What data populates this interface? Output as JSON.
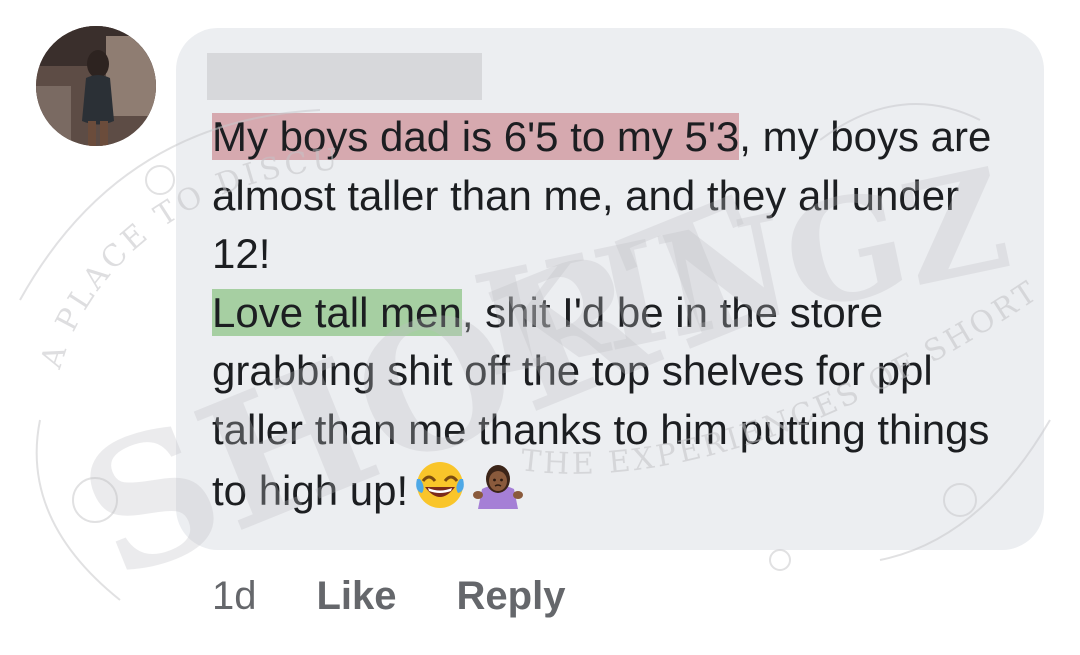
{
  "comment": {
    "author_name_redacted": true,
    "text": {
      "highlight_1": "My boys dad is 6'5 to my 5'3",
      "part_1": ", my boys are almost taller than me, and they all under 12!",
      "highlight_2": "Love tall men",
      "part_2": ", shit I'd be in the store grabbing shit off the top shelves for ppl taller than me thanks to him putting things to high up!"
    },
    "emojis": [
      "laughing-tears-emoji",
      "woman-shrugging-emoji"
    ],
    "highlight_colors": {
      "red": "#c47178",
      "green": "#78ba6e"
    }
  },
  "actions": {
    "timestamp": "1d",
    "like_label": "Like",
    "reply_label": "Reply"
  },
  "watermark": {
    "top_arc": "A PLACE TO DISCUSS",
    "brand_line1": "SHORT",
    "brand_line2": "KINGZ",
    "bottom_arc": "THE EXPERIENCES OF SHORTER MEN"
  },
  "colors": {
    "bubble": "#eceef1",
    "text": "#1c1e21",
    "action_text": "#65676b"
  }
}
